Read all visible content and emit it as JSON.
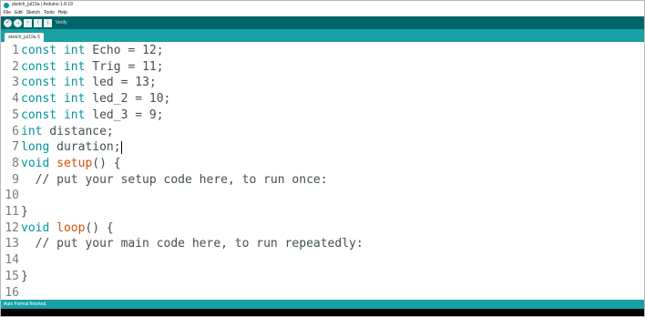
{
  "window": {
    "title": "sketch_jul19a | Arduino 1.8.19"
  },
  "menu": {
    "items": [
      "File",
      "Edit",
      "Sketch",
      "Tools",
      "Help"
    ]
  },
  "toolbar": {
    "verify_icon": "check-icon",
    "upload_icon": "arrow-right-icon",
    "new_icon": "new-file-icon",
    "open_icon": "open-arrow-up-icon",
    "save_icon": "save-arrow-down-icon",
    "label": "Verify"
  },
  "tabs": [
    {
      "label": "sketch_jul19a §"
    }
  ],
  "editor": {
    "lines": [
      {
        "n": "1",
        "parts": [
          [
            "kw",
            "const int"
          ],
          [
            "",
            " Echo = 12;"
          ]
        ]
      },
      {
        "n": "2",
        "parts": [
          [
            "kw",
            "const int"
          ],
          [
            "",
            " Trig = 11;"
          ]
        ]
      },
      {
        "n": "3",
        "parts": [
          [
            "kw",
            "const int"
          ],
          [
            "",
            " led = 13;"
          ]
        ]
      },
      {
        "n": "4",
        "parts": [
          [
            "kw",
            "const int"
          ],
          [
            "",
            " led_2 = 10;"
          ]
        ]
      },
      {
        "n": "5",
        "parts": [
          [
            "kw",
            "const int"
          ],
          [
            "",
            " led_3 = 9;"
          ]
        ]
      },
      {
        "n": "6",
        "parts": [
          [
            "kw",
            "int"
          ],
          [
            "",
            " distance;"
          ]
        ]
      },
      {
        "n": "7",
        "parts": [
          [
            "kw",
            "long"
          ],
          [
            "",
            " duration;"
          ]
        ],
        "caret": true
      },
      {
        "n": "8",
        "parts": [
          [
            "kw",
            "void"
          ],
          [
            "",
            " "
          ],
          [
            "fn",
            "setup"
          ],
          [
            "",
            "() {"
          ]
        ]
      },
      {
        "n": "9",
        "parts": [
          [
            "cm",
            "  // put your setup code here, to run once:"
          ]
        ]
      },
      {
        "n": "10",
        "parts": []
      },
      {
        "n": "11",
        "parts": [
          [
            "",
            "}"
          ]
        ]
      },
      {
        "n": "12",
        "parts": [
          [
            "kw",
            "void"
          ],
          [
            "",
            " "
          ],
          [
            "fn",
            "loop"
          ],
          [
            "",
            "() {"
          ]
        ]
      },
      {
        "n": "13",
        "parts": [
          [
            "cm",
            "  // put your main code here, to run repeatedly:"
          ]
        ]
      },
      {
        "n": "14",
        "parts": []
      },
      {
        "n": "15",
        "parts": [
          [
            "",
            "}"
          ]
        ]
      },
      {
        "n": "16",
        "parts": []
      }
    ]
  },
  "status": {
    "text": "Auto Format finished."
  },
  "colors": {
    "toolbar_bg": "#006468",
    "tabstrip_bg": "#17a1a5",
    "keyword": "#00979c",
    "function": "#d35400",
    "text": "#434f54"
  }
}
